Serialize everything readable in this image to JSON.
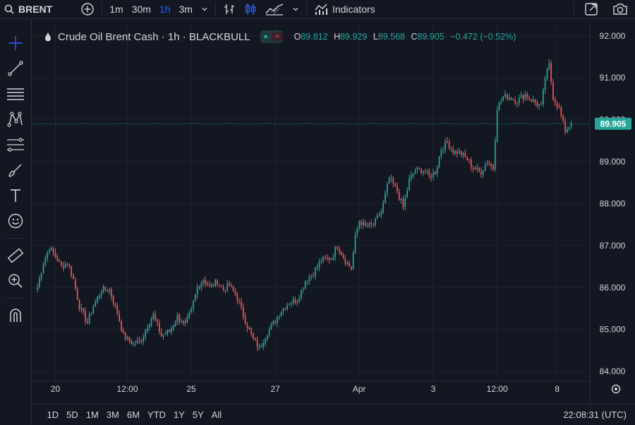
{
  "toolbar": {
    "symbol": "BRENT",
    "intervals": [
      "1m",
      "30m",
      "1h",
      "3m"
    ],
    "active_interval": "1h",
    "indicators_label": "Indicators",
    "icons": [
      "search-icon",
      "plus-circle-icon",
      "chevron-down-icon",
      "bar-type-icon",
      "candles-icon",
      "area-icon",
      "chevron-down-icon",
      "indicators-icon",
      "fullscreen-icon",
      "camera-icon"
    ]
  },
  "left_tools": [
    "crosshair-icon",
    "trend-line-icon",
    "horizontal-lines-icon",
    "pattern-icon",
    "fib-icon",
    "brush-icon",
    "text-icon",
    "emoji-icon",
    "ruler-icon",
    "zoom-in-icon",
    "magnet-icon"
  ],
  "legend": {
    "title": "Crude Oil Brent Cash · 1h · BLACKBULL",
    "open_label": "O",
    "open": "89.812",
    "high_label": "H",
    "high": "89.929",
    "low_label": "L",
    "low": "89.568",
    "close_label": "C",
    "close": "89.905",
    "change": "−0.472 (−0.52%)"
  },
  "bottom": {
    "ranges": [
      "1D",
      "5D",
      "1M",
      "3M",
      "6M",
      "YTD",
      "1Y",
      "5Y",
      "All"
    ],
    "clock": "22:08:31 (UTC)"
  },
  "colors": {
    "up": "#26a69a",
    "down": "#ef5350",
    "background": "#131722",
    "grid": "#1f2330",
    "accent": "#2962ff"
  },
  "chart_data": {
    "type": "candlestick",
    "y_ticks": [
      "92.000",
      "91.000",
      "90.000",
      "89.000",
      "88.000",
      "87.000",
      "86.000",
      "85.000",
      "84.000"
    ],
    "y_tick_values": [
      92,
      91,
      90,
      89,
      88,
      87,
      86,
      85,
      84
    ],
    "ylim": [
      83.85,
      92.35
    ],
    "x_ticks": [
      "20",
      "12:00",
      "25",
      "27",
      "Apr",
      "3",
      "12:00",
      "8"
    ],
    "x_tick_index": [
      9,
      45,
      77,
      119,
      161,
      198,
      230,
      260
    ],
    "xlim": [
      0,
      270
    ],
    "current_price": 89.905,
    "current_price_label": "89.905",
    "anchors": [
      [
        0,
        86.0
      ],
      [
        3,
        86.6
      ],
      [
        6,
        86.95
      ],
      [
        9,
        86.75
      ],
      [
        12,
        86.5
      ],
      [
        15,
        86.6
      ],
      [
        18,
        86.2
      ],
      [
        21,
        85.55
      ],
      [
        25,
        85.15
      ],
      [
        28,
        85.55
      ],
      [
        32,
        85.95
      ],
      [
        36,
        85.95
      ],
      [
        40,
        85.4
      ],
      [
        43,
        84.85
      ],
      [
        48,
        84.65
      ],
      [
        52,
        84.75
      ],
      [
        55,
        85.1
      ],
      [
        58,
        85.35
      ],
      [
        62,
        84.85
      ],
      [
        66,
        84.95
      ],
      [
        70,
        85.3
      ],
      [
        74,
        85.1
      ],
      [
        77,
        85.45
      ],
      [
        80,
        86.0
      ],
      [
        83,
        86.2
      ],
      [
        86,
        86.0
      ],
      [
        90,
        86.15
      ],
      [
        93,
        85.95
      ],
      [
        96,
        86.05
      ],
      [
        100,
        85.75
      ],
      [
        104,
        85.2
      ],
      [
        108,
        84.75
      ],
      [
        111,
        84.55
      ],
      [
        114,
        84.85
      ],
      [
        118,
        85.15
      ],
      [
        122,
        85.45
      ],
      [
        126,
        85.65
      ],
      [
        130,
        85.7
      ],
      [
        134,
        86.15
      ],
      [
        138,
        86.35
      ],
      [
        142,
        86.65
      ],
      [
        147,
        86.7
      ],
      [
        150,
        87.0
      ],
      [
        154,
        86.65
      ],
      [
        157,
        86.45
      ],
      [
        159,
        87.2
      ],
      [
        161,
        87.6
      ],
      [
        164,
        87.45
      ],
      [
        168,
        87.5
      ],
      [
        172,
        87.8
      ],
      [
        176,
        88.6
      ],
      [
        180,
        88.3
      ],
      [
        183,
        87.9
      ],
      [
        186,
        88.55
      ],
      [
        189,
        88.8
      ],
      [
        193,
        88.8
      ],
      [
        196,
        88.65
      ],
      [
        199,
        88.75
      ],
      [
        202,
        89.3
      ],
      [
        205,
        89.45
      ],
      [
        208,
        89.25
      ],
      [
        212,
        89.2
      ],
      [
        215,
        89.05
      ],
      [
        218,
        88.85
      ],
      [
        222,
        88.75
      ],
      [
        225,
        89.0
      ],
      [
        228,
        88.85
      ],
      [
        230,
        90.3
      ],
      [
        233,
        90.55
      ],
      [
        236,
        90.55
      ],
      [
        240,
        90.45
      ],
      [
        244,
        90.6
      ],
      [
        248,
        90.45
      ],
      [
        252,
        90.3
      ],
      [
        254,
        91.0
      ],
      [
        256,
        91.3
      ],
      [
        258,
        90.55
      ],
      [
        261,
        90.25
      ],
      [
        264,
        89.75
      ],
      [
        267,
        89.905
      ]
    ]
  }
}
